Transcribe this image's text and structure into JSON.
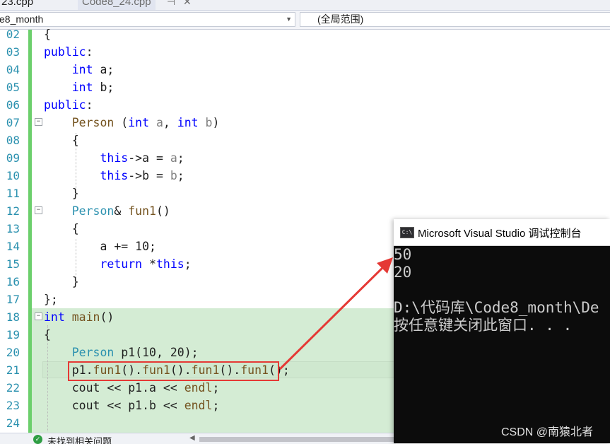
{
  "tabs": {
    "tab1_label": "23.cpp",
    "tab2_label": "Code8_24.cpp",
    "pin_icon": "pin-icon",
    "close_icon": "close-icon"
  },
  "nav": {
    "scope_value": "e8_month",
    "member_value": "(全局范围)"
  },
  "editor": {
    "line_numbers": [
      "02",
      "03",
      "04",
      "05",
      "06",
      "07",
      "08",
      "09",
      "10",
      "11",
      "12",
      "13",
      "14",
      "15",
      "16",
      "17",
      "18",
      "19",
      "20",
      "21",
      "22",
      "23",
      "24"
    ],
    "lines": [
      [
        {
          "t": "{",
          "c": ""
        }
      ],
      [
        {
          "t": "public",
          "c": "kw"
        },
        {
          "t": ":",
          "c": ""
        }
      ],
      [
        {
          "t": "    ",
          "c": ""
        },
        {
          "t": "int",
          "c": "kw"
        },
        {
          "t": " a;",
          "c": ""
        }
      ],
      [
        {
          "t": "    ",
          "c": ""
        },
        {
          "t": "int",
          "c": "kw"
        },
        {
          "t": " b;",
          "c": ""
        }
      ],
      [
        {
          "t": "public",
          "c": "kw"
        },
        {
          "t": ":",
          "c": ""
        }
      ],
      [
        {
          "t": "    ",
          "c": ""
        },
        {
          "t": "Person",
          "c": "fn"
        },
        {
          "t": " (",
          "c": ""
        },
        {
          "t": "int",
          "c": "kw"
        },
        {
          "t": " ",
          "c": ""
        },
        {
          "t": "a",
          "c": "pr"
        },
        {
          "t": ", ",
          "c": ""
        },
        {
          "t": "int",
          "c": "kw"
        },
        {
          "t": " ",
          "c": ""
        },
        {
          "t": "b",
          "c": "pr"
        },
        {
          "t": ")",
          "c": ""
        }
      ],
      [
        {
          "t": "    {",
          "c": ""
        }
      ],
      [
        {
          "t": "        ",
          "c": ""
        },
        {
          "t": "this",
          "c": "kw"
        },
        {
          "t": "->a = ",
          "c": ""
        },
        {
          "t": "a",
          "c": "pr"
        },
        {
          "t": ";",
          "c": ""
        }
      ],
      [
        {
          "t": "        ",
          "c": ""
        },
        {
          "t": "this",
          "c": "kw"
        },
        {
          "t": "->b = ",
          "c": ""
        },
        {
          "t": "b",
          "c": "pr"
        },
        {
          "t": ";",
          "c": ""
        }
      ],
      [
        {
          "t": "    }",
          "c": ""
        }
      ],
      [
        {
          "t": "    ",
          "c": ""
        },
        {
          "t": "Person",
          "c": "ty"
        },
        {
          "t": "& ",
          "c": ""
        },
        {
          "t": "fun1",
          "c": "fn"
        },
        {
          "t": "()",
          "c": ""
        }
      ],
      [
        {
          "t": "    {",
          "c": ""
        }
      ],
      [
        {
          "t": "        a += 10;",
          "c": ""
        }
      ],
      [
        {
          "t": "        ",
          "c": ""
        },
        {
          "t": "return",
          "c": "kw"
        },
        {
          "t": " *",
          "c": ""
        },
        {
          "t": "this",
          "c": "kw"
        },
        {
          "t": ";",
          "c": ""
        }
      ],
      [
        {
          "t": "    }",
          "c": ""
        }
      ],
      [
        {
          "t": "};",
          "c": ""
        }
      ],
      [
        {
          "t": "int",
          "c": "kw"
        },
        {
          "t": " ",
          "c": ""
        },
        {
          "t": "main",
          "c": "fn"
        },
        {
          "t": "()",
          "c": ""
        }
      ],
      [
        {
          "t": "{",
          "c": ""
        }
      ],
      [
        {
          "t": "    ",
          "c": ""
        },
        {
          "t": "Person",
          "c": "ty"
        },
        {
          "t": " p1(10, 20);",
          "c": ""
        }
      ],
      [
        {
          "t": "    p1.",
          "c": ""
        },
        {
          "t": "fun1",
          "c": "fn"
        },
        {
          "t": "().",
          "c": ""
        },
        {
          "t": "fun1",
          "c": "fn"
        },
        {
          "t": "().",
          "c": ""
        },
        {
          "t": "fun1",
          "c": "fn"
        },
        {
          "t": "().",
          "c": ""
        },
        {
          "t": "fun1",
          "c": "fn"
        },
        {
          "t": "();",
          "c": ""
        }
      ],
      [
        {
          "t": "    cout << p1.a << ",
          "c": ""
        },
        {
          "t": "endl",
          "c": "fn"
        },
        {
          "t": ";",
          "c": ""
        }
      ],
      [
        {
          "t": "    cout << p1.b << ",
          "c": ""
        },
        {
          "t": "endl",
          "c": "fn"
        },
        {
          "t": ";",
          "c": ""
        }
      ],
      [
        {
          "t": "",
          "c": ""
        }
      ]
    ]
  },
  "status": {
    "icon": "check-circle-icon",
    "text": "未找到相关问题"
  },
  "console": {
    "title": "Microsoft Visual Studio 调试控制台",
    "icon": "console-app-icon",
    "lines": [
      "50",
      "20",
      "",
      "D:\\代码库\\Code8_month\\De",
      "按任意键关闭此窗口. . ."
    ],
    "watermark": "CSDN @南猿北者"
  },
  "colors": {
    "keyword": "#0000ff",
    "type": "#2b91af",
    "function": "#74531f",
    "param": "#808080",
    "highlight_box": "#e53935",
    "change_bar": "#6ccf6c",
    "console_bg": "#0c0c0c"
  }
}
